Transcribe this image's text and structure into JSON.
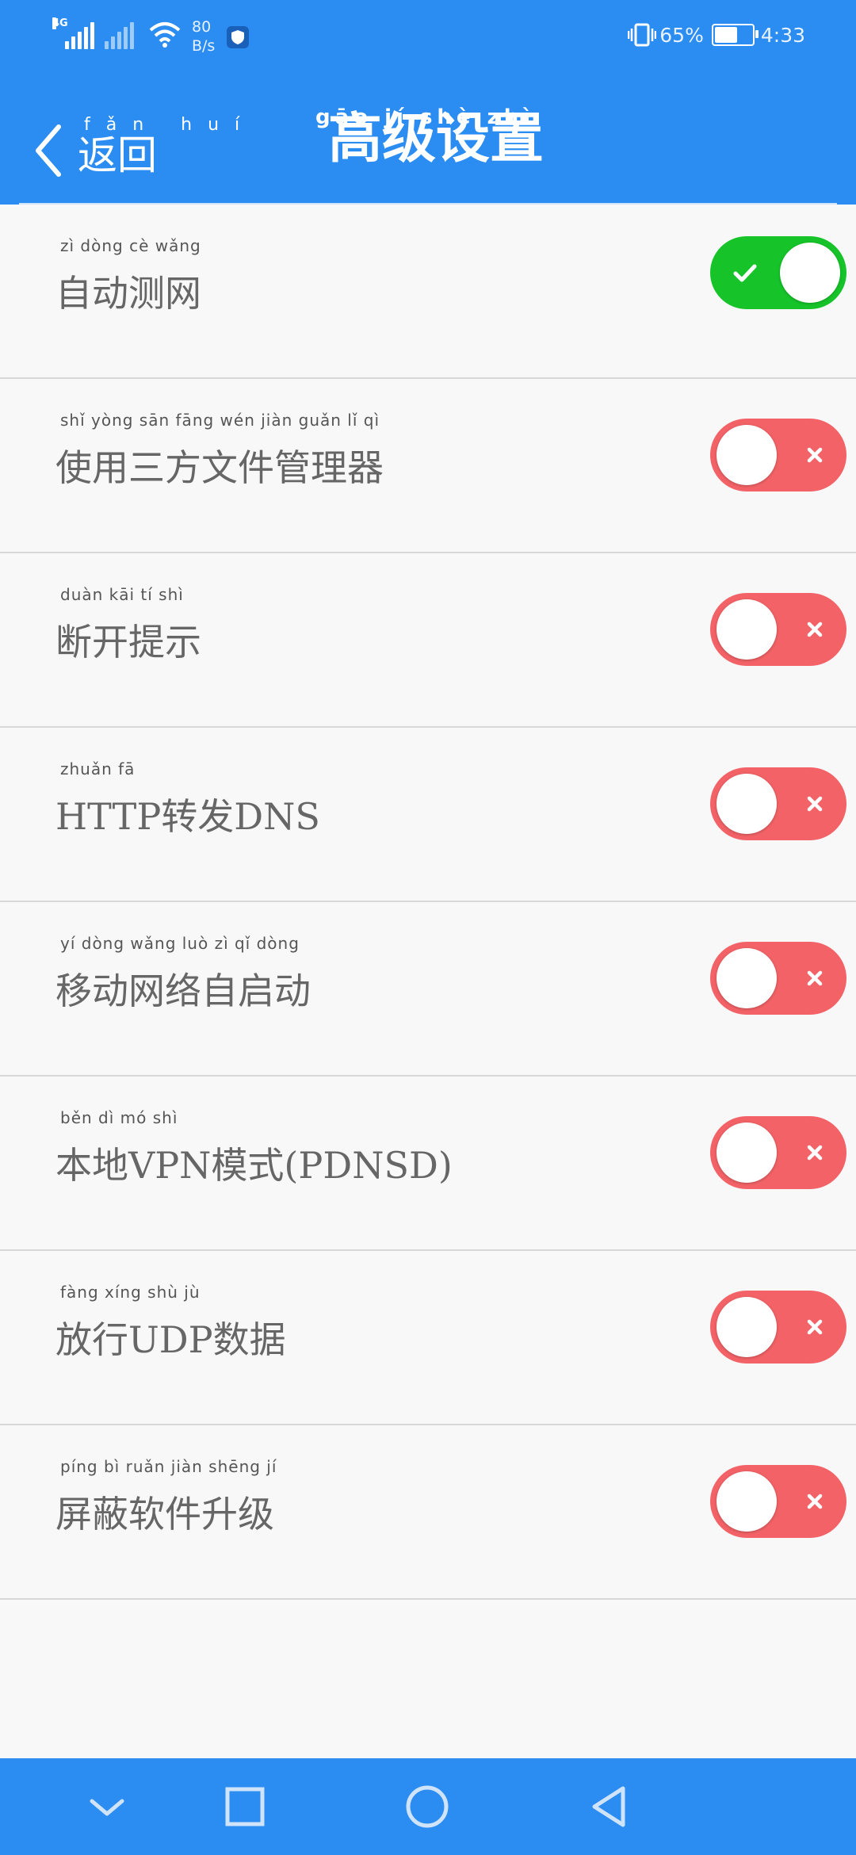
{
  "status_bar": {
    "network_type": "4G",
    "speed_value": "80",
    "speed_unit": "B/s",
    "battery_text": "65%",
    "battery_level": 0.65,
    "time": "4:33"
  },
  "header": {
    "back_label": "返回",
    "back_pinyin": "fǎn huí",
    "title": "高级设置",
    "title_pinyin": "gāo jí shè zhì"
  },
  "settings": [
    {
      "label": "自动测网",
      "pinyin": "zì dòng cè wǎng",
      "enabled": true
    },
    {
      "label": "使用三方文件管理器",
      "pinyin": "shǐ yòng sān fāng wén jiàn guǎn lǐ qì",
      "enabled": false
    },
    {
      "label": "断开提示",
      "pinyin": "duàn kāi tí shì",
      "enabled": false
    },
    {
      "label": "HTTP转发DNS",
      "pinyin": "zhuǎn fā",
      "enabled": false
    },
    {
      "label": "移动网络自启动",
      "pinyin": "yí dòng wǎng luò zì qǐ dòng",
      "enabled": false
    },
    {
      "label": "本地VPN模式(PDNSD)",
      "pinyin": "běn dì mó shì",
      "enabled": false
    },
    {
      "label": "放行UDP数据",
      "pinyin": "fàng xíng shù jù",
      "enabled": false
    },
    {
      "label": "屏蔽软件升级",
      "pinyin": "píng bì ruǎn jiàn shēng jí",
      "enabled": false
    }
  ],
  "colors": {
    "primary": "#2b8cf2",
    "toggle_on": "#16c42a",
    "toggle_off": "#f26266"
  },
  "icons": {
    "toggle_on": "check-icon",
    "toggle_off": "x-icon",
    "back": "chevron-left-icon",
    "nav": [
      "chevron-down-icon",
      "square-icon",
      "circle-icon",
      "triangle-back-icon"
    ]
  }
}
